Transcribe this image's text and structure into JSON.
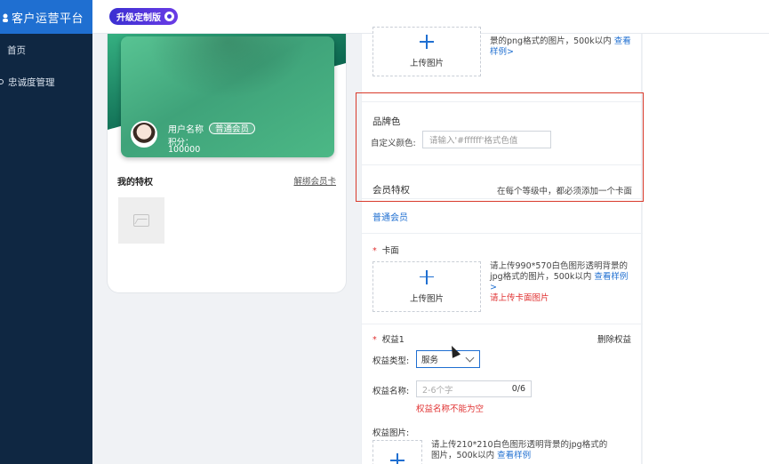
{
  "app": {
    "brand": "客户运营平台",
    "upgrade_badge": "升级定制版"
  },
  "sidebar": {
    "items": [
      {
        "label": "首页"
      },
      {
        "label": "忠诚度管理"
      }
    ]
  },
  "preview": {
    "user_name": "用户名称",
    "member_badge": "普通会员",
    "points_label": "积分：",
    "points_value": "100000",
    "privilege_title": "我的特权",
    "unbind_link": "解绑会员卡"
  },
  "panel": {
    "top_upload": {
      "label": "上传图片",
      "hint": "景的png格式的图片，500k以内",
      "view_sample": "查看样例>"
    },
    "brand_color": {
      "title": "品牌色",
      "custom_label": "自定义颜色:",
      "placeholder": "请输入'#ffffff'格式色值"
    },
    "privileges": {
      "title": "会员特权",
      "note": "在每个等级中，都必须添加一个卡面"
    },
    "level_tab": "普通会员",
    "card_face": {
      "label": "卡面",
      "upload_label": "上传图片",
      "hint": "请上传990*570白色图形透明背景的jpg格式的图片，500k以内",
      "view_sample": "查看样例",
      "sample_arrow": ">",
      "error": "请上传卡面图片"
    },
    "benefit": {
      "label": "权益1",
      "delete": "删除权益",
      "type_label": "权益类型:",
      "type_value": "服务",
      "name_label": "权益名称:",
      "name_placeholder": "2-6个字",
      "name_count": "0/6",
      "name_error": "权益名称不能为空",
      "image_label": "权益图片:",
      "image_hint": "请上传210*210白色图形透明背景的jpg格式的图片，500k以内",
      "image_view_sample": "查看样例"
    }
  },
  "colors": {
    "brand_blue": "#1f6fd1",
    "sidebar_bg": "#0f2742",
    "card_green": "#4cb886",
    "error_red": "#e03131",
    "highlight_red": "#d93a2b"
  }
}
